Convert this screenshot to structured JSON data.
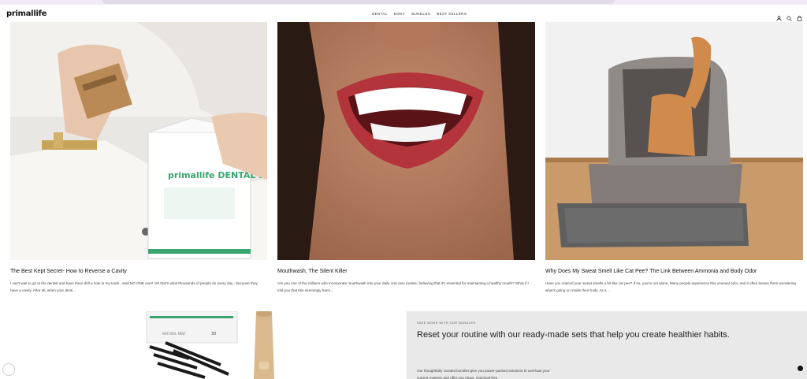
{
  "brand": {
    "logo_text": "primallife"
  },
  "nav": {
    "items": [
      "DENTAL",
      "BODY",
      "BUNDLES",
      "BEST SELLERS"
    ]
  },
  "header_icons": [
    "account-icon",
    "search-icon",
    "cart-icon"
  ],
  "posts": [
    {
      "title": "The Best Kept Secret- How to Reverse a Cavity",
      "excerpt": "I can't wait to go to the dentist and have them drill a hole in my tooth...said NO ONE ever! Yet that's what thousands of people do every day - because they have a cavity. After all, when your denti...",
      "image_box_text": "primallife DENTAL DETOX"
    },
    {
      "title": "Mouthwash, The Silent Killer",
      "excerpt": "Are you one of the millions who incorporate mouthwash into your daily oral care routine, believing that it's essential for maintaining a healthy mouth? What if I told you that this seemingly harm..."
    },
    {
      "title": "Why Does My Sweat Smell Like Cat Pee? The Link Between Ammonia and Body Odor",
      "excerpt": "Have you noticed your sweat smells a bit like cat pee? If so, you're not alone. Many people experience this unusual odor, and it often leaves them wondering what's going on inside their body. As s..."
    }
  ],
  "promo": {
    "eyebrow": "SAVE MORE WITH OUR BUNDLES",
    "title": "Reset your routine with our ready-made sets that help you create healthier habits.",
    "body": "Our thoughtfully curated bundles give you power-packed solutions to overhaul your current routines and offer you clean, chemical-free"
  },
  "bundle_image": {
    "box_label": "NATURAL MINT",
    "count_label": "30"
  },
  "colors": {
    "promo_bg": "#e9e9e9",
    "text": "#222222",
    "accent": "#111111"
  }
}
